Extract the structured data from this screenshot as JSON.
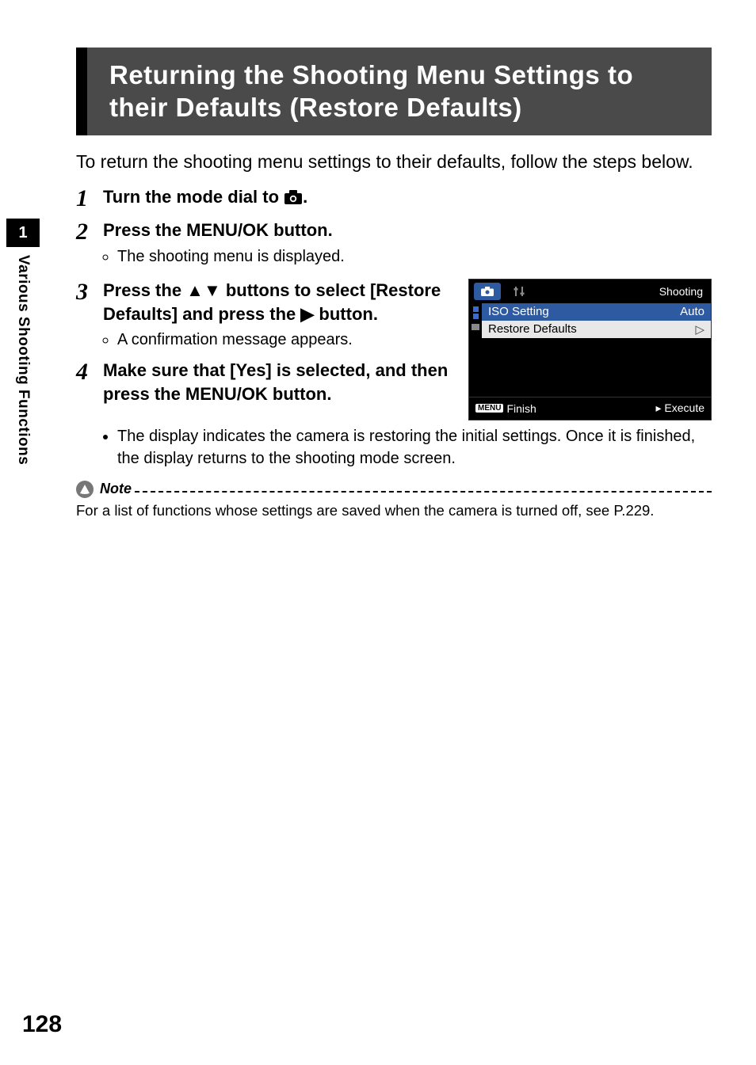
{
  "title": "Returning the Shooting Menu Settings to their Defaults (Restore Defaults)",
  "intro": "To return the shooting menu settings to their defaults, follow the steps below.",
  "steps": {
    "s1_a": "Turn the mode dial to ",
    "s1_b": ".",
    "s2": "Press the MENU/OK button.",
    "s2_sub": "The shooting menu is displayed.",
    "s3_a": "Press the ",
    "s3_b": " buttons to select [Restore Defaults] and press the ",
    "s3_c": " button.",
    "s3_sub": "A confirmation message appears.",
    "s4": "Make sure that [Yes] is selected, and then press the MENU/OK button.",
    "s4_sub": "The display indicates the camera is restoring the initial settings. Once it is finished, the display returns to the shooting mode screen."
  },
  "note": {
    "label": "Note",
    "body": "For a list of functions whose settings are saved when the camera is turned off, see P.229."
  },
  "screenshot": {
    "title": "Shooting",
    "row1_label": "ISO Setting",
    "row1_value": "Auto",
    "row2_label": "Restore Defaults",
    "footer_finish": "Finish",
    "footer_menu": "MENU",
    "footer_execute": "Execute"
  },
  "side": {
    "number": "1",
    "label": "Various Shooting Functions"
  },
  "page_number": "128"
}
